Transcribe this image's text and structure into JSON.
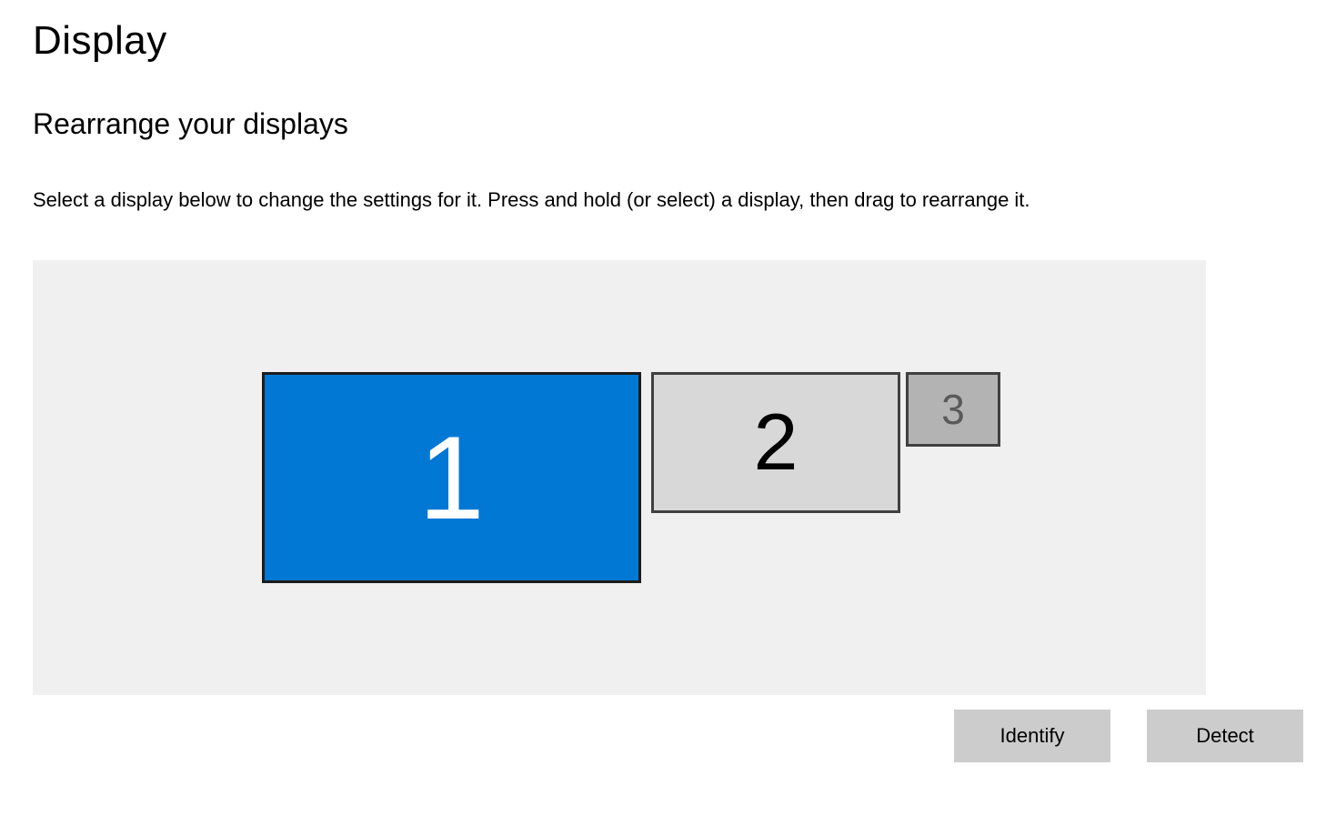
{
  "page": {
    "title": "Display",
    "section_heading": "Rearrange your displays",
    "description": "Select a display below to change the settings for it. Press and hold (or select) a display, then drag to rearrange it."
  },
  "monitors": [
    {
      "label": "1",
      "selected": true
    },
    {
      "label": "2",
      "selected": false
    },
    {
      "label": "3",
      "selected": false
    }
  ],
  "buttons": {
    "identify": "Identify",
    "detect": "Detect"
  }
}
